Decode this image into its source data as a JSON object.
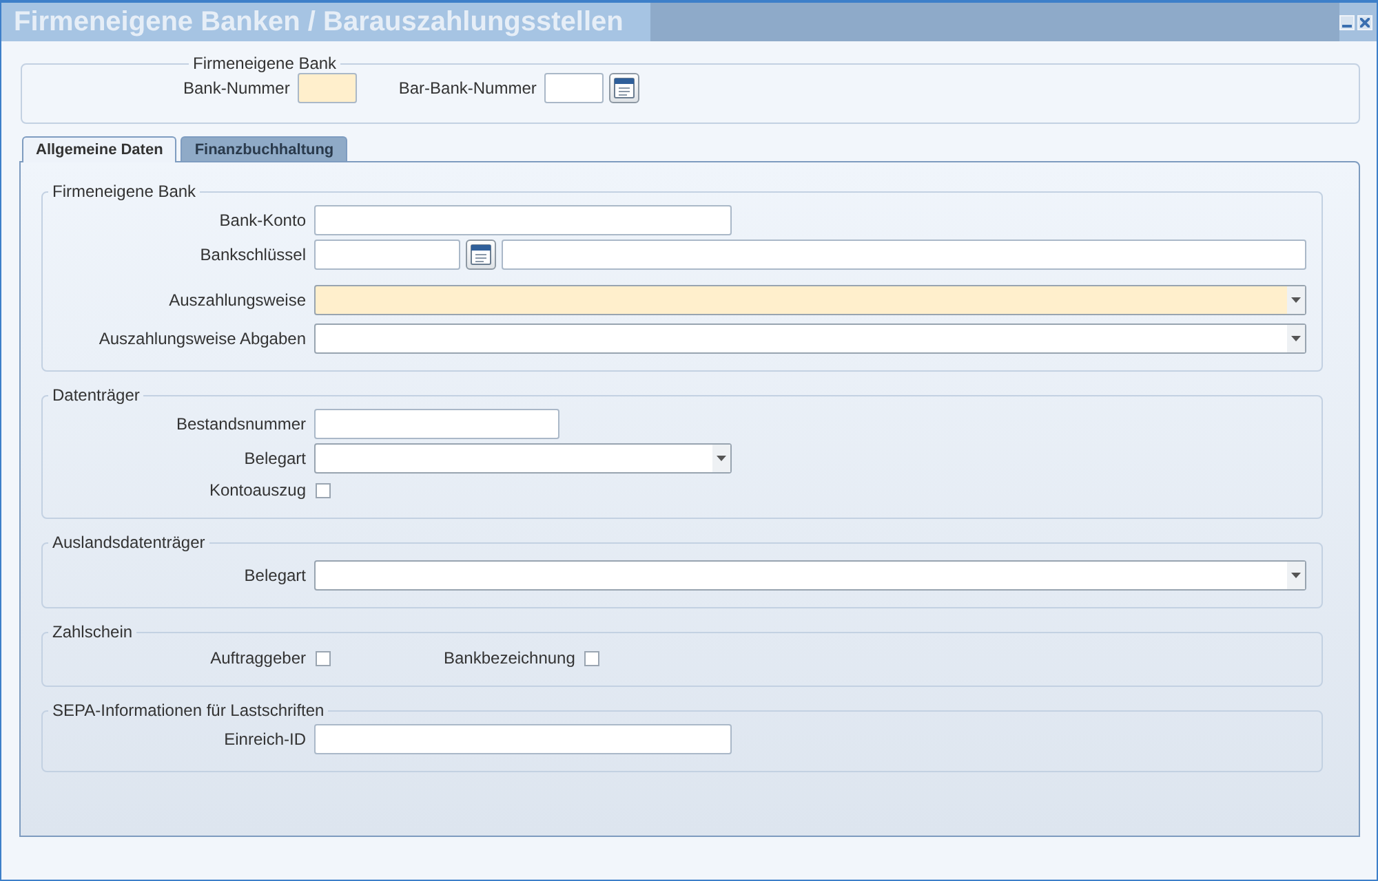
{
  "window": {
    "title": "Firmeneigene Banken / Barauszahlungsstellen"
  },
  "header_group": {
    "legend": "Firmeneigene Bank",
    "fields": [
      {
        "label": "Bank-Nummer",
        "kind": "tiny-text",
        "required": true
      },
      {
        "label": "Bar-Bank-Nummer",
        "kind": "tiny-lookup",
        "required": false
      }
    ]
  },
  "tabs": [
    {
      "label": "Allgemeine Daten",
      "selected": true
    },
    {
      "label": "Finanzbuchhaltung",
      "selected": false
    }
  ],
  "sections": [
    {
      "legend": "Firmeneigene Bank",
      "rows": [
        [
          {
            "label": "Bank-Konto",
            "kind": "medium-text",
            "required": false
          }
        ],
        [
          {
            "label": "Bankschlüssel",
            "kind": "lookup",
            "required": false
          }
        ],
        [
          {
            "label": "Auszahlungsweise",
            "kind": "long-select",
            "required": true
          }
        ],
        [
          {
            "label": "Auszahlungsweise Abgaben",
            "kind": "long-select",
            "required": false
          }
        ]
      ]
    },
    {
      "legend": "Datenträger",
      "rows": [
        [
          {
            "label": "Bestandsnummer",
            "kind": "short-text",
            "required": false
          }
        ],
        [
          {
            "label": "Belegart",
            "kind": "medium-select",
            "required": false
          }
        ],
        [
          {
            "label": "Kontoauszug",
            "kind": "checkbox",
            "checked": false
          }
        ]
      ]
    },
    {
      "legend": "Auslandsdatenträger",
      "rows": [
        [
          {
            "label": "Belegart",
            "kind": "long-select",
            "required": false
          }
        ]
      ]
    },
    {
      "legend": "Zahlschein",
      "rows": [
        [
          {
            "label": "Auftraggeber",
            "kind": "checkbox",
            "checked": false
          },
          {
            "label": "Bankbezeichnung",
            "kind": "checkbox",
            "checked": false
          }
        ]
      ]
    },
    {
      "legend": "SEPA-Informationen für Lastschriften",
      "rows": [
        [
          {
            "label": "Einreich-ID",
            "kind": "medium-text",
            "required": false
          }
        ]
      ]
    }
  ]
}
